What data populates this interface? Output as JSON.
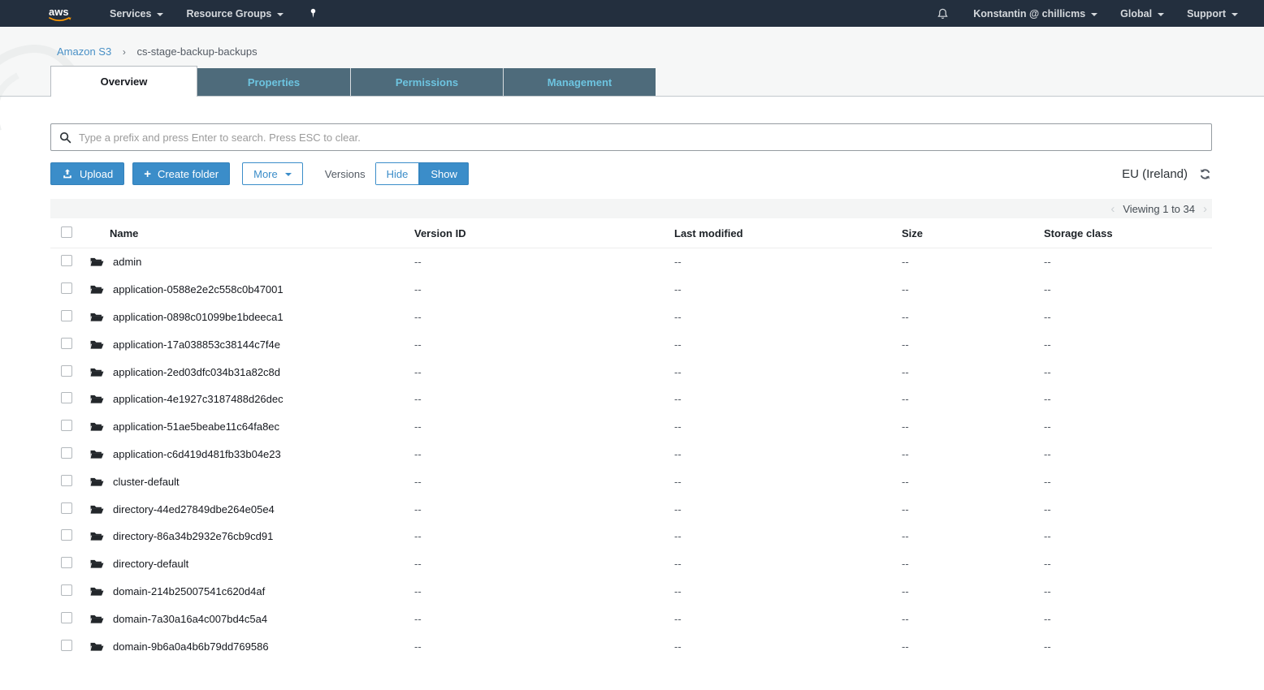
{
  "nav": {
    "logo_text": "aws",
    "services_label": "Services",
    "resource_groups_label": "Resource Groups",
    "user_label": "Konstantin @ chillicms",
    "region_menu_label": "Global",
    "support_label": "Support"
  },
  "breadcrumb": {
    "link": "Amazon S3",
    "separator": "›",
    "current": "cs-stage-backup-backups"
  },
  "tabs": [
    {
      "label": "Overview",
      "active": true
    },
    {
      "label": "Properties",
      "active": false
    },
    {
      "label": "Permissions",
      "active": false
    },
    {
      "label": "Management",
      "active": false
    }
  ],
  "search": {
    "placeholder": "Type a prefix and press Enter to search. Press ESC to clear."
  },
  "toolbar": {
    "upload_label": "Upload",
    "plus_glyph": "+",
    "create_folder_label": "Create folder",
    "more_label": "More",
    "versions_label": "Versions",
    "hide_label": "Hide",
    "show_label": "Show",
    "region": "EU (Ireland)"
  },
  "pagination": {
    "prev_glyph": "‹",
    "viewing_text": "Viewing 1 to 34",
    "next_glyph": "›"
  },
  "table": {
    "columns": [
      "Name",
      "Version ID",
      "Last modified",
      "Size",
      "Storage class"
    ],
    "empty_value": "--",
    "rows": [
      "admin",
      "application-0588e2e2c558c0b47001",
      "application-0898c01099be1bdeeca1",
      "application-17a038853c38144c7f4e",
      "application-2ed03dfc034b31a82c8d",
      "application-4e1927c3187488d26dec",
      "application-51ae5beabe11c64fa8ec",
      "application-c6d419d481fb33b04e23",
      "cluster-default",
      "directory-44ed27849dbe264e05e4",
      "directory-86a34b2932e76cb9cd91",
      "directory-default",
      "domain-214b25007541c620d4af",
      "domain-7a30a16a4c007bd4c5a4",
      "domain-9b6a0a4b6b79dd769586"
    ]
  },
  "colors": {
    "nav_bg": "#232f3e",
    "accent_blue": "#3b8dc9",
    "logo_orange": "#ff9900",
    "tab_inactive_bg": "#4e6b7b",
    "tab_inactive_text": "#6dc4e0"
  }
}
